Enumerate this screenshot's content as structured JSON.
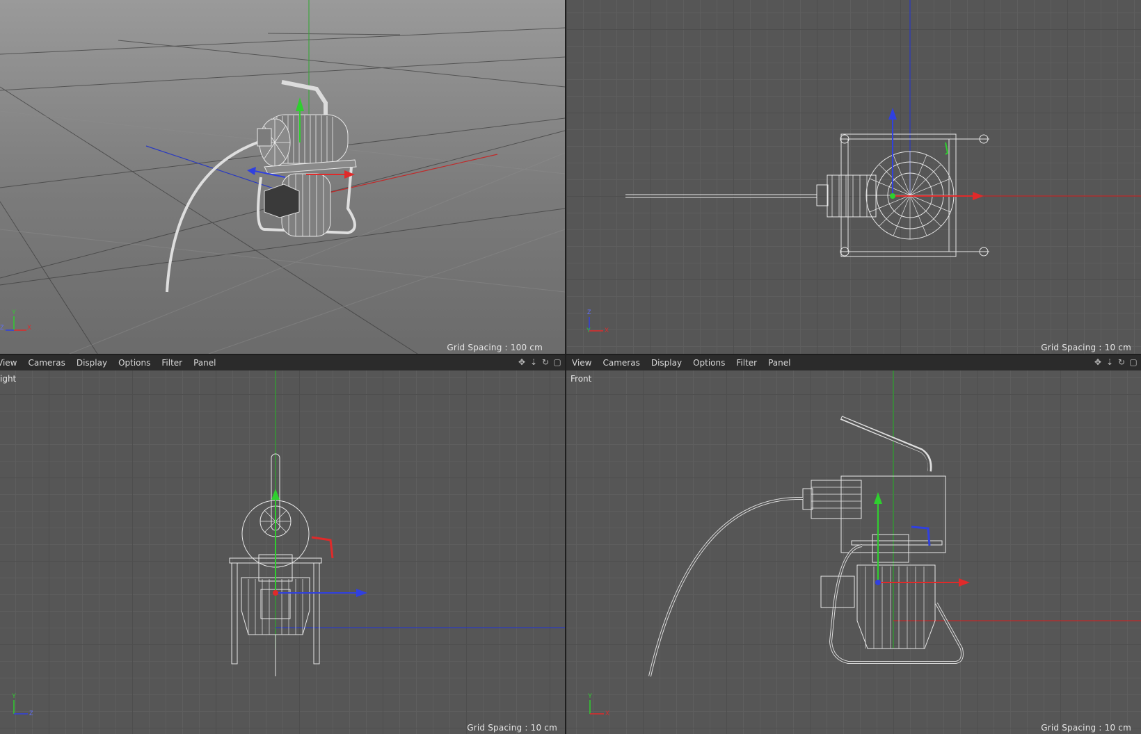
{
  "viewports": {
    "perspective": {
      "grid_spacing": "Grid Spacing : 100 cm"
    },
    "top": {
      "grid_spacing": "Grid Spacing : 10 cm"
    },
    "right": {
      "label": "ight",
      "grid_spacing": "Grid Spacing : 10 cm"
    },
    "front": {
      "label": "Front",
      "grid_spacing": "Grid Spacing : 10 cm"
    }
  },
  "menu_left": {
    "items": [
      "View",
      "Cameras",
      "Display",
      "Options",
      "Filter",
      "Panel"
    ]
  },
  "menu_right": {
    "items": [
      "View",
      "Cameras",
      "Display",
      "Options",
      "Filter",
      "Panel"
    ]
  },
  "toolbar_icons": [
    "move-icon",
    "dolly-icon",
    "rotate-icon",
    "maximize-icon"
  ],
  "axis_gizmo": {
    "perspective": {
      "a": "Y",
      "b": "Z",
      "c": "X"
    },
    "top": {
      "a": "Z",
      "b": "Y",
      "c": "X"
    },
    "right": {
      "a": "Y",
      "b": "Z"
    },
    "front": {
      "a": "Y",
      "b": "X"
    }
  },
  "colors": {
    "x_axis": "#e03030",
    "y_axis": "#30c030",
    "z_axis": "#3040e0",
    "wire": "#e8e8e8",
    "viewport_bg": "#565656",
    "grid": "#616161"
  }
}
